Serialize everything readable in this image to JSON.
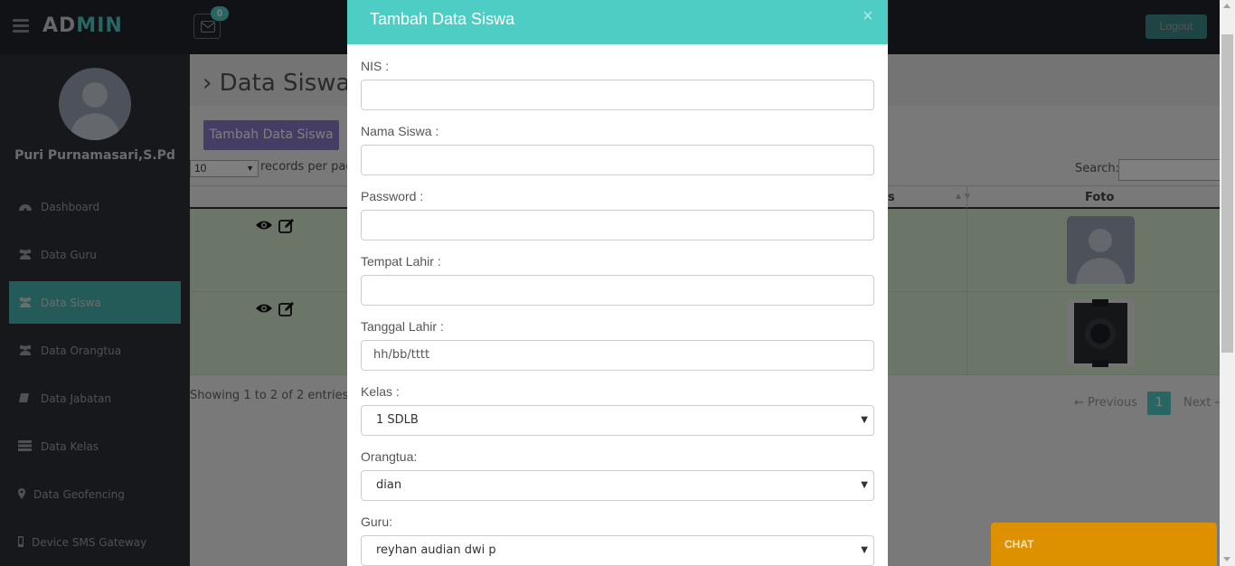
{
  "app": {
    "logo_part1": "AD",
    "logo_part2": "MIN",
    "mail_count": "0",
    "logout_label": "Logout"
  },
  "user": {
    "name": "Puri Purnamasari,S.Pd"
  },
  "sidebar": {
    "items": [
      {
        "label": "Dashboard",
        "icon": "dashboard-icon"
      },
      {
        "label": "Data Guru",
        "icon": "users-icon"
      },
      {
        "label": "Data Siswa",
        "icon": "users-icon",
        "active": true
      },
      {
        "label": "Data Orangtua",
        "icon": "users-icon"
      },
      {
        "label": "Data Jabatan",
        "icon": "book-icon"
      },
      {
        "label": "Data Kelas",
        "icon": "server-icon"
      },
      {
        "label": "Data Geofencing",
        "icon": "map-marker-icon"
      },
      {
        "label": "Device SMS Gateway",
        "icon": "mobile-icon"
      }
    ]
  },
  "main": {
    "title": "Data Siswa",
    "add_button": "Tambah Data Siswa",
    "page_length": "10",
    "page_length_label": "records per page",
    "search_label": "Search:",
    "columns": {
      "partial": "s",
      "photo": "Foto"
    },
    "info": "Showing 1 to 2 of 2 entries",
    "pagination": {
      "prev": "← Previous",
      "current": "1",
      "next": "Next →"
    }
  },
  "modal": {
    "title": "Tambah Data Siswa",
    "close": "×",
    "fields": {
      "nis": {
        "label": "NIS :",
        "value": ""
      },
      "nama": {
        "label": "Nama Siswa :",
        "value": ""
      },
      "password": {
        "label": "Password :",
        "value": ""
      },
      "tempat": {
        "label": "Tempat Lahir :",
        "value": ""
      },
      "tanggal": {
        "label": "Tanggal Lahir :",
        "placeholder": "hh/bb/tttt"
      },
      "kelas": {
        "label": "Kelas :",
        "selected": "1 SDLB"
      },
      "orangtua": {
        "label": "Orangtua:",
        "selected": "dian"
      },
      "guru": {
        "label": "Guru:",
        "selected": "reyhan audian dwi p"
      }
    }
  },
  "chat": {
    "label": "CHAT"
  },
  "colors": {
    "accent": "#4ecdc4",
    "sidebar": "#2d3036",
    "topbar": "#22242a",
    "add_button": "#8a7bc7",
    "chat": "#dd9000",
    "row": "#d8ecd0"
  }
}
